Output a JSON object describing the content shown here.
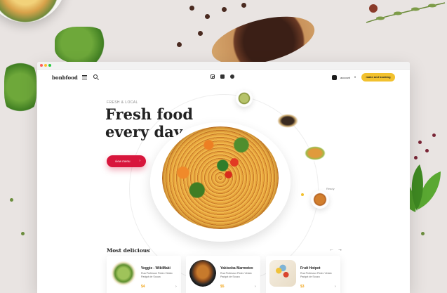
{
  "nav": {
    "brand": "bonbfood",
    "account_label": "account",
    "account_chevron": "▾",
    "book_label": "make and booking",
    "social_icons": [
      "instagram-icon",
      "linkedin-icon",
      "facebook-icon"
    ]
  },
  "hero": {
    "eyebrow": "FRESH & LOCAL",
    "headline_line1": "Fresh food",
    "headline_line2": "every day",
    "cta_label": "view menu",
    "cta_arrow": "›",
    "mini_label": "Ready"
  },
  "section": {
    "title": "Most delicious",
    "chevron": "›",
    "prev_arrow": "←",
    "next_arrow": "→"
  },
  "cards": [
    {
      "title": "Veggie - WikiMaki",
      "desc": "Rua Professor Pedro Viriato Parigot de Souza",
      "price": "$4",
      "chevron": "›"
    },
    {
      "title": "Yakisoba Marmotex",
      "desc": "Rua Professor Pedro Viriato Parigot de Souza",
      "price": "$5",
      "chevron": "›"
    },
    {
      "title": "Fruit Hotpot",
      "desc": "Rua Professor Pedro Viriato Parigot de Souza",
      "price": "$3",
      "chevron": "›"
    }
  ],
  "colors": {
    "accent_red": "#d8163c",
    "accent_yellow": "#f2c12e",
    "price": "#f2a51a",
    "background": "#e9e4e2"
  }
}
